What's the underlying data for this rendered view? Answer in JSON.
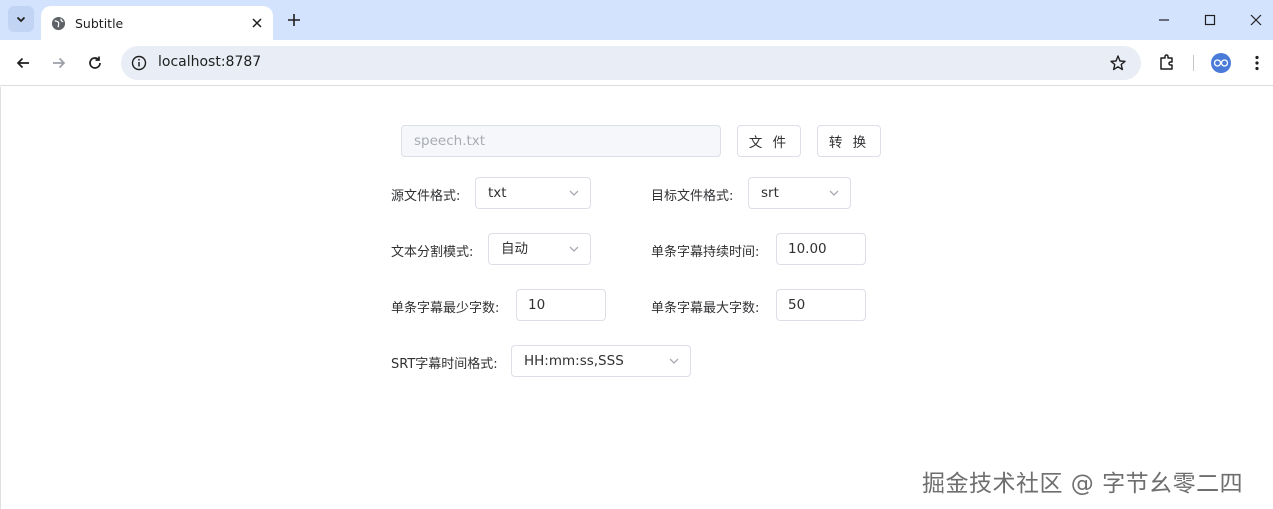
{
  "browser": {
    "tab_title": "Subtitle",
    "url": "localhost:8787",
    "icons": {
      "tab_search": "chevron-down-icon",
      "favicon": "globe-icon",
      "tab_close": "close-icon",
      "new_tab": "plus-icon",
      "minimize": "minimize-icon",
      "maximize": "maximize-icon",
      "close_window": "close-icon",
      "back": "arrow-left-icon",
      "forward": "arrow-right-icon",
      "reload": "reload-icon",
      "site_info": "info-icon",
      "bookmark": "star-icon",
      "extensions": "puzzle-icon",
      "profile": "avatar-icon",
      "menu": "more-vert-icon"
    }
  },
  "form": {
    "file_input": {
      "placeholder": "speech.txt"
    },
    "file_button": "文 件",
    "convert_button": "转 换",
    "source_format": {
      "label": "源文件格式:",
      "value": "txt"
    },
    "target_format": {
      "label": "目标文件格式:",
      "value": "srt"
    },
    "split_mode": {
      "label": "文本分割模式:",
      "value": "自动"
    },
    "duration": {
      "label": "单条字幕持续时间:",
      "value": "10.00"
    },
    "min_chars": {
      "label": "单条字幕最少字数:",
      "value": "10"
    },
    "max_chars": {
      "label": "单条字幕最大字数:",
      "value": "50"
    },
    "srt_time_format": {
      "label": "SRT字幕时间格式:",
      "value": "HH:mm:ss,SSS"
    }
  },
  "watermark": "掘金技术社区 @ 字节幺零二四",
  "colors": {
    "tabstrip": "#d3e3fd",
    "omnibox": "#e9eef6",
    "input_border": "#dcdfe6",
    "disabled_bg": "#f5f7fa",
    "placeholder": "#a8abb2"
  }
}
